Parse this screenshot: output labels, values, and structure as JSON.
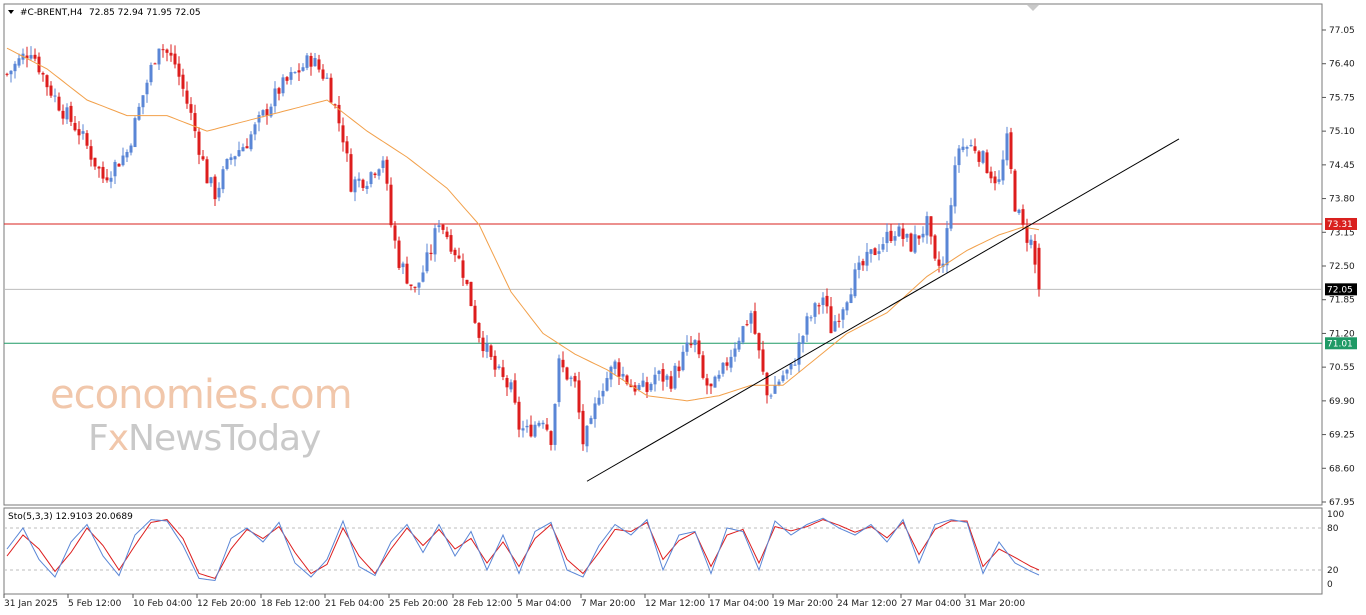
{
  "header": {
    "symbol": "#C-BRENT,H4",
    "ohlc": "72.85 72.94 71.95 72.05"
  },
  "watermark": {
    "line1": "economies.com",
    "line2_a": "F",
    "line2_b": "x",
    "line2_c": "NewsToday"
  },
  "levels": {
    "resistance": {
      "label": "73.31",
      "value": 73.31,
      "color": "#d9201e"
    },
    "current": {
      "label": "72.05",
      "value": 72.05,
      "color": "#000000"
    },
    "support": {
      "label": "71.01",
      "value": 71.01,
      "color": "#1f9a66"
    }
  },
  "colors": {
    "bull": "#5a86d6",
    "bear": "#dd1d1d",
    "ma": "#f2a04a",
    "trend": "#000000",
    "stoch_main": "#5a86d6",
    "stoch_signal": "#dd1d1d"
  },
  "indicator": {
    "label": "Sto(5,3,3) 12.9103 20.0689",
    "levels": [
      "100",
      "80",
      "20",
      "0"
    ],
    "level_values": [
      100,
      80,
      20,
      0
    ]
  },
  "chart_data": {
    "type": "candlestick",
    "title": "#C-BRENT,H4",
    "ylim": [
      67.75,
      77.3
    ],
    "y_ticks": [
      "77.05",
      "76.40",
      "75.75",
      "75.10",
      "74.45",
      "73.80",
      "73.15",
      "72.50",
      "71.85",
      "71.20",
      "70.55",
      "69.90",
      "69.25",
      "68.60",
      "67.95"
    ],
    "x_ticks": [
      "31 Jan 2025",
      "5 Feb 12:00",
      "10 Feb 04:00",
      "12 Feb 20:00",
      "18 Feb 12:00",
      "21 Feb 04:00",
      "25 Feb 20:00",
      "28 Feb 12:00",
      "5 Mar 04:00",
      "7 Mar 20:00",
      "12 Mar 12:00",
      "17 Mar 04:00",
      "19 Mar 20:00",
      "24 Mar 12:00",
      "27 Mar 04:00",
      "31 Mar 20:00"
    ],
    "close_path": [
      [
        0,
        76.2
      ],
      [
        6,
        76.7
      ],
      [
        10,
        76.0
      ],
      [
        14,
        75.5
      ],
      [
        18,
        75.1
      ],
      [
        22,
        74.5
      ],
      [
        24,
        74.2
      ],
      [
        30,
        74.7
      ],
      [
        34,
        75.8
      ],
      [
        38,
        76.8
      ],
      [
        42,
        76.4
      ],
      [
        46,
        75.4
      ],
      [
        50,
        74.2
      ],
      [
        52,
        73.9
      ],
      [
        56,
        74.6
      ],
      [
        60,
        74.9
      ],
      [
        64,
        75.4
      ],
      [
        68,
        75.9
      ],
      [
        72,
        76.2
      ],
      [
        76,
        76.5
      ],
      [
        80,
        76.1
      ],
      [
        84,
        75.0
      ],
      [
        86,
        74.1
      ],
      [
        90,
        74.2
      ],
      [
        94,
        74.6
      ],
      [
        96,
        73.3
      ],
      [
        98,
        72.6
      ],
      [
        102,
        72.0
      ],
      [
        106,
        72.8
      ],
      [
        108,
        73.4
      ],
      [
        112,
        72.8
      ],
      [
        114,
        72.4
      ],
      [
        118,
        71.2
      ],
      [
        122,
        70.5
      ],
      [
        126,
        70.1
      ],
      [
        128,
        69.4
      ],
      [
        130,
        69.3
      ],
      [
        134,
        69.6
      ],
      [
        136,
        69.2
      ],
      [
        138,
        70.6
      ],
      [
        142,
        70.2
      ],
      [
        144,
        69.1
      ],
      [
        146,
        69.4
      ],
      [
        148,
        70.1
      ],
      [
        152,
        70.6
      ],
      [
        156,
        70.2
      ],
      [
        160,
        70.1
      ],
      [
        162,
        70.4
      ],
      [
        166,
        70.3
      ],
      [
        170,
        70.9
      ],
      [
        172,
        71.0
      ],
      [
        174,
        70.3
      ],
      [
        176,
        70.1
      ],
      [
        178,
        70.3
      ],
      [
        182,
        71.0
      ],
      [
        186,
        71.6
      ],
      [
        188,
        70.8
      ],
      [
        190,
        70.0
      ],
      [
        194,
        70.4
      ],
      [
        196,
        70.5
      ],
      [
        200,
        71.4
      ],
      [
        204,
        71.9
      ],
      [
        206,
        71.3
      ],
      [
        208,
        71.6
      ],
      [
        212,
        72.3
      ],
      [
        214,
        72.5
      ],
      [
        218,
        72.9
      ],
      [
        222,
        73.2
      ],
      [
        226,
        72.9
      ],
      [
        230,
        73.3
      ],
      [
        232,
        72.5
      ],
      [
        234,
        72.5
      ],
      [
        236,
        73.8
      ],
      [
        238,
        74.8
      ],
      [
        242,
        74.8
      ],
      [
        246,
        74.3
      ],
      [
        248,
        74.1
      ],
      [
        250,
        74.9
      ],
      [
        252,
        73.7
      ],
      [
        254,
        73.2
      ],
      [
        256,
        72.95
      ],
      [
        258,
        72.05
      ]
    ],
    "moving_average": [
      [
        0,
        76.7
      ],
      [
        10,
        76.3
      ],
      [
        20,
        75.7
      ],
      [
        30,
        75.4
      ],
      [
        40,
        75.4
      ],
      [
        50,
        75.1
      ],
      [
        60,
        75.3
      ],
      [
        70,
        75.5
      ],
      [
        80,
        75.7
      ],
      [
        90,
        75.1
      ],
      [
        100,
        74.6
      ],
      [
        110,
        74.0
      ],
      [
        118,
        73.3
      ],
      [
        126,
        72.0
      ],
      [
        134,
        71.2
      ],
      [
        142,
        70.8
      ],
      [
        150,
        70.5
      ],
      [
        160,
        70.0
      ],
      [
        170,
        69.9
      ],
      [
        178,
        70.0
      ],
      [
        186,
        70.2
      ],
      [
        194,
        70.2
      ],
      [
        202,
        70.7
      ],
      [
        210,
        71.2
      ],
      [
        220,
        71.6
      ],
      [
        230,
        72.3
      ],
      [
        240,
        72.8
      ],
      [
        248,
        73.1
      ],
      [
        254,
        73.25
      ],
      [
        258,
        73.2
      ]
    ],
    "trendline": [
      [
        145,
        68.35
      ],
      [
        293,
        74.95
      ]
    ],
    "stochastic": {
      "k": [
        [
          0,
          50
        ],
        [
          4,
          80
        ],
        [
          8,
          35
        ],
        [
          12,
          10
        ],
        [
          16,
          60
        ],
        [
          20,
          85
        ],
        [
          24,
          40
        ],
        [
          28,
          12
        ],
        [
          32,
          70
        ],
        [
          36,
          92
        ],
        [
          40,
          90
        ],
        [
          44,
          55
        ],
        [
          48,
          8
        ],
        [
          52,
          5
        ],
        [
          56,
          65
        ],
        [
          60,
          80
        ],
        [
          64,
          60
        ],
        [
          68,
          88
        ],
        [
          72,
          30
        ],
        [
          76,
          10
        ],
        [
          80,
          35
        ],
        [
          84,
          90
        ],
        [
          88,
          25
        ],
        [
          92,
          12
        ],
        [
          96,
          60
        ],
        [
          100,
          85
        ],
        [
          104,
          45
        ],
        [
          108,
          85
        ],
        [
          112,
          40
        ],
        [
          116,
          75
        ],
        [
          120,
          20
        ],
        [
          124,
          70
        ],
        [
          128,
          15
        ],
        [
          132,
          75
        ],
        [
          136,
          88
        ],
        [
          140,
          20
        ],
        [
          144,
          10
        ],
        [
          148,
          55
        ],
        [
          152,
          85
        ],
        [
          156,
          70
        ],
        [
          160,
          92
        ],
        [
          164,
          20
        ],
        [
          168,
          70
        ],
        [
          172,
          75
        ],
        [
          176,
          15
        ],
        [
          180,
          80
        ],
        [
          184,
          75
        ],
        [
          188,
          20
        ],
        [
          192,
          90
        ],
        [
          196,
          70
        ],
        [
          200,
          85
        ],
        [
          204,
          94
        ],
        [
          208,
          80
        ],
        [
          212,
          70
        ],
        [
          216,
          85
        ],
        [
          220,
          60
        ],
        [
          224,
          92
        ],
        [
          228,
          30
        ],
        [
          232,
          85
        ],
        [
          236,
          92
        ],
        [
          240,
          88
        ],
        [
          244,
          15
        ],
        [
          248,
          60
        ],
        [
          252,
          30
        ],
        [
          256,
          18
        ],
        [
          258,
          12.9
        ]
      ],
      "d": [
        [
          0,
          40
        ],
        [
          4,
          70
        ],
        [
          8,
          50
        ],
        [
          12,
          18
        ],
        [
          16,
          45
        ],
        [
          20,
          80
        ],
        [
          24,
          55
        ],
        [
          28,
          20
        ],
        [
          32,
          55
        ],
        [
          36,
          88
        ],
        [
          40,
          92
        ],
        [
          44,
          65
        ],
        [
          48,
          15
        ],
        [
          52,
          8
        ],
        [
          56,
          50
        ],
        [
          60,
          78
        ],
        [
          64,
          65
        ],
        [
          68,
          82
        ],
        [
          72,
          45
        ],
        [
          76,
          15
        ],
        [
          80,
          28
        ],
        [
          84,
          80
        ],
        [
          88,
          40
        ],
        [
          92,
          15
        ],
        [
          96,
          50
        ],
        [
          100,
          80
        ],
        [
          104,
          55
        ],
        [
          108,
          78
        ],
        [
          112,
          50
        ],
        [
          116,
          65
        ],
        [
          120,
          30
        ],
        [
          124,
          60
        ],
        [
          128,
          25
        ],
        [
          132,
          65
        ],
        [
          136,
          85
        ],
        [
          140,
          35
        ],
        [
          144,
          15
        ],
        [
          148,
          45
        ],
        [
          152,
          78
        ],
        [
          156,
          75
        ],
        [
          160,
          88
        ],
        [
          164,
          35
        ],
        [
          168,
          62
        ],
        [
          172,
          74
        ],
        [
          176,
          25
        ],
        [
          180,
          70
        ],
        [
          184,
          78
        ],
        [
          188,
          30
        ],
        [
          192,
          82
        ],
        [
          196,
          76
        ],
        [
          200,
          82
        ],
        [
          204,
          92
        ],
        [
          208,
          84
        ],
        [
          212,
          74
        ],
        [
          216,
          82
        ],
        [
          220,
          66
        ],
        [
          224,
          88
        ],
        [
          228,
          42
        ],
        [
          232,
          78
        ],
        [
          236,
          90
        ],
        [
          240,
          90
        ],
        [
          244,
          25
        ],
        [
          248,
          50
        ],
        [
          252,
          38
        ],
        [
          256,
          25
        ],
        [
          258,
          20.07
        ]
      ]
    }
  }
}
